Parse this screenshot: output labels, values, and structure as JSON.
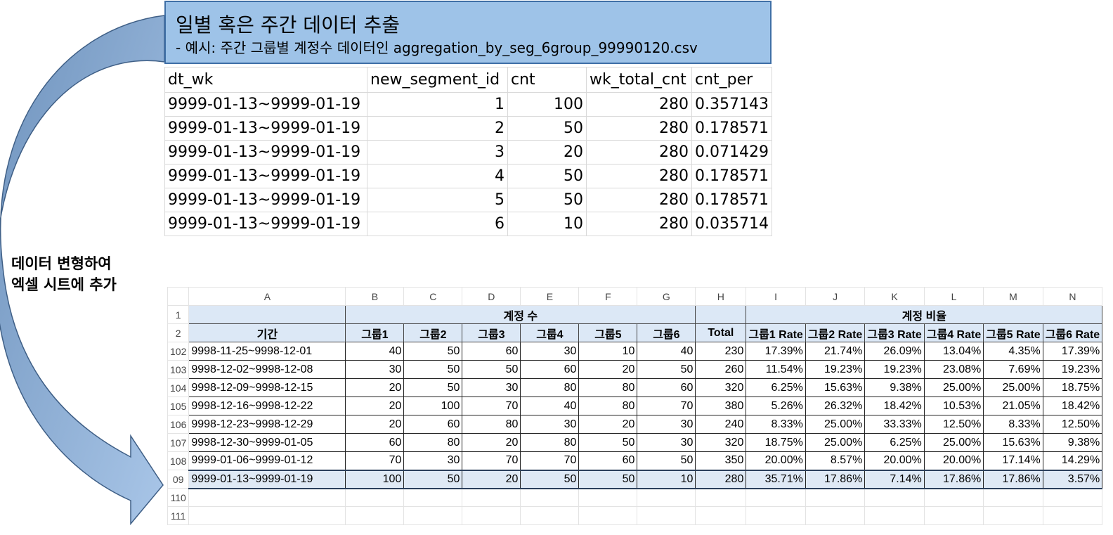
{
  "banner": {
    "title": "일별 혹은 주간 데이터 추출",
    "subtitle": "- 예시: 주간 그룹별 계정수 데이터인 aggregation_by_seg_6group_99990120.csv"
  },
  "side_label": {
    "line1": "데이터 변형하여",
    "line2": "엑셀 시트에 추가"
  },
  "csv": {
    "headers": [
      "dt_wk",
      "new_segment_id",
      "cnt",
      "wk_total_cnt",
      "cnt_per"
    ],
    "rows": [
      [
        "9999-01-13~9999-01-19",
        "1",
        "100",
        "280",
        "0.357143"
      ],
      [
        "9999-01-13~9999-01-19",
        "2",
        "50",
        "280",
        "0.178571"
      ],
      [
        "9999-01-13~9999-01-19",
        "3",
        "20",
        "280",
        "0.071429"
      ],
      [
        "9999-01-13~9999-01-19",
        "4",
        "50",
        "280",
        "0.178571"
      ],
      [
        "9999-01-13~9999-01-19",
        "5",
        "50",
        "280",
        "0.178571"
      ],
      [
        "9999-01-13~9999-01-19",
        "6",
        "10",
        "280",
        "0.035714"
      ]
    ]
  },
  "sheet": {
    "columns": [
      "A",
      "B",
      "C",
      "D",
      "E",
      "F",
      "G",
      "H",
      "I",
      "J",
      "K",
      "L",
      "M",
      "N"
    ],
    "header_row1": {
      "row_num": "1",
      "count_label": "계정 수",
      "ratio_label": "계정 비율"
    },
    "header_row2": {
      "row_num": "2",
      "labels": [
        "기간",
        "그룹1",
        "그룹2",
        "그룹3",
        "그룹4",
        "그룹5",
        "그룹6",
        "Total",
        "그룹1 Rate",
        "그룹2 Rate",
        "그룹3 Rate",
        "그룹4 Rate",
        "그룹5 Rate",
        "그룹6 Rate"
      ]
    },
    "rows": [
      {
        "num": "102",
        "cells": [
          "9998-11-25~9998-12-01",
          "40",
          "50",
          "60",
          "30",
          "10",
          "40",
          "230",
          "17.39%",
          "21.74%",
          "26.09%",
          "13.04%",
          "4.35%",
          "17.39%"
        ]
      },
      {
        "num": "103",
        "cells": [
          "9998-12-02~9998-12-08",
          "30",
          "50",
          "50",
          "60",
          "20",
          "50",
          "260",
          "11.54%",
          "19.23%",
          "19.23%",
          "23.08%",
          "7.69%",
          "19.23%"
        ]
      },
      {
        "num": "104",
        "cells": [
          "9998-12-09~9998-12-15",
          "20",
          "50",
          "30",
          "80",
          "80",
          "60",
          "320",
          "6.25%",
          "15.63%",
          "9.38%",
          "25.00%",
          "25.00%",
          "18.75%"
        ]
      },
      {
        "num": "105",
        "cells": [
          "9998-12-16~9998-12-22",
          "20",
          "100",
          "70",
          "40",
          "80",
          "70",
          "380",
          "5.26%",
          "26.32%",
          "18.42%",
          "10.53%",
          "21.05%",
          "18.42%"
        ]
      },
      {
        "num": "106",
        "cells": [
          "9998-12-23~9998-12-29",
          "20",
          "60",
          "80",
          "30",
          "20",
          "30",
          "240",
          "8.33%",
          "25.00%",
          "33.33%",
          "12.50%",
          "8.33%",
          "12.50%"
        ]
      },
      {
        "num": "107",
        "cells": [
          "9998-12-30~9999-01-05",
          "60",
          "80",
          "20",
          "80",
          "50",
          "30",
          "320",
          "18.75%",
          "25.00%",
          "6.25%",
          "25.00%",
          "15.63%",
          "9.38%"
        ]
      },
      {
        "num": "108",
        "cells": [
          "9999-01-06~9999-01-12",
          "70",
          "30",
          "70",
          "70",
          "60",
          "50",
          "350",
          "20.00%",
          "8.57%",
          "20.00%",
          "20.00%",
          "17.14%",
          "14.29%"
        ]
      },
      {
        "num": "09",
        "cells": [
          "9999-01-13~9999-01-19",
          "100",
          "50",
          "20",
          "50",
          "50",
          "10",
          "280",
          "35.71%",
          "17.86%",
          "7.14%",
          "17.86%",
          "17.86%",
          "3.57%"
        ],
        "selected": true
      }
    ],
    "empty_rows": [
      "110",
      "111"
    ]
  },
  "colors": {
    "banner_bg": "#9ec3e8",
    "arrow_fill": "#8fb3dc",
    "header_fill": "#dce8f6",
    "selected_row": "#dfe9f5"
  }
}
